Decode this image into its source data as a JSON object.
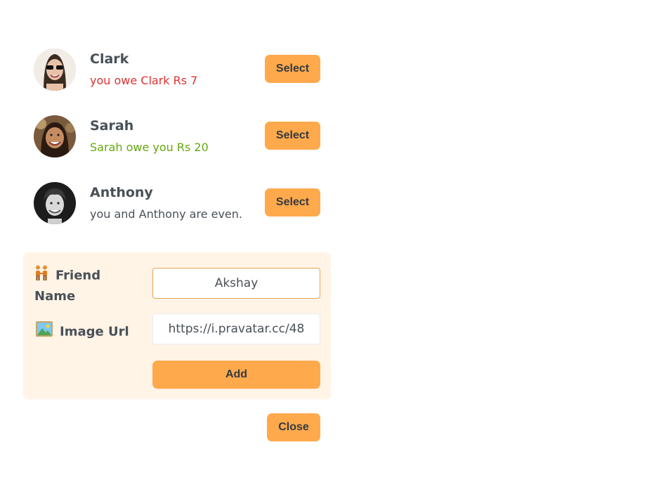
{
  "friends": [
    {
      "name": "Clark",
      "status": "you owe Clark Rs 7",
      "status_type": "owe",
      "select_label": "Select"
    },
    {
      "name": "Sarah",
      "status": "Sarah owe you Rs 20",
      "status_type": "owed",
      "select_label": "Select"
    },
    {
      "name": "Anthony",
      "status": "you and Anthony are even.",
      "status_type": "even",
      "select_label": "Select"
    }
  ],
  "add_friend_form": {
    "name_label": "Friend Name",
    "name_icon": "people-holding-hands-icon",
    "name_value": "Akshay",
    "image_label": "Image Url",
    "image_icon": "framed-picture-icon",
    "image_value": "https://i.pravatar.cc/48",
    "add_label": "Add"
  },
  "close_label": "Close",
  "colors": {
    "accent": "#ffa94d",
    "form_bg": "#fff4e6",
    "owe": "#e03131",
    "owed": "#66a80f",
    "text": "#495057"
  }
}
